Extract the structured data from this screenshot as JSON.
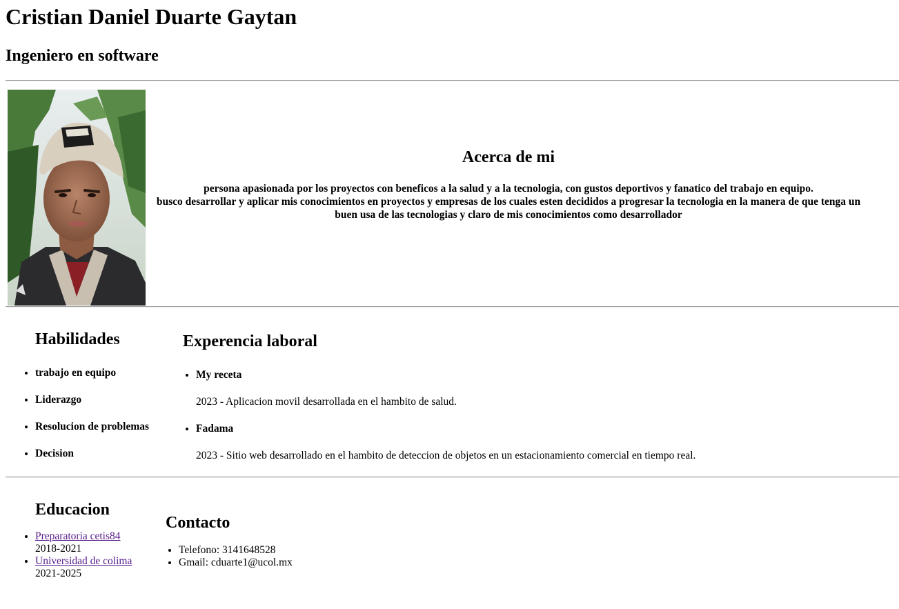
{
  "header": {
    "name": "Cristian Daniel Duarte Gaytan",
    "title": "Ingeniero en software"
  },
  "about": {
    "heading": "Acerca de mi",
    "line1": "persona apasionada por los proyectos con beneficos a la salud y a la tecnologia, con gustos deportivos y fanatico del trabajo en equipo.",
    "line2": "busco desarrollar y aplicar mis conocimientos en proyectos y empresas de los cuales esten decididos a progresar la tecnologia en la manera de que tenga un buen usa de las tecnologias y claro de mis conocimientos como desarrollador"
  },
  "skills": {
    "heading": "Habilidades",
    "items": [
      "trabajo en equipo",
      "Liderazgo",
      "Resolucion de problemas",
      "Decision"
    ]
  },
  "experience": {
    "heading": "Experencia laboral",
    "items": [
      {
        "name": "My receta",
        "description": "2023 - Aplicacion movil desarrollada en el hambito de salud."
      },
      {
        "name": "Fadama",
        "description": "2023 - Sitio web desarrollado en el hambito de deteccion de objetos en un estacionamiento comercial en tiempo real."
      }
    ]
  },
  "education": {
    "heading": "Educacion",
    "items": [
      {
        "name": "Preparatoria cetis84",
        "years": "2018-2021"
      },
      {
        "name": "Universidad de colima",
        "years": "2021-2025"
      }
    ]
  },
  "contact": {
    "heading": "Contacto",
    "phone": "Telefono: 3141648528",
    "email": "Gmail: cduarte1@ucol.mx"
  }
}
